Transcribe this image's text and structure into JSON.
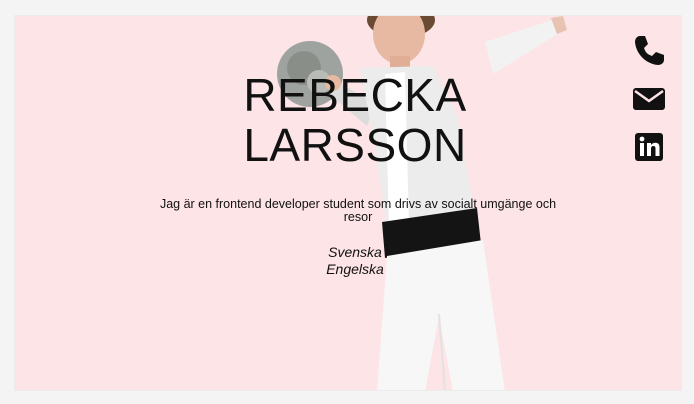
{
  "profile": {
    "first_name": "REBECKA",
    "last_name": "LARSSON",
    "tagline": "Jag är en frontend developer student som drivs av socialt umgänge och resor",
    "languages": [
      "Svenska",
      "Engelska"
    ]
  },
  "contact": {
    "icons": [
      "phone-icon",
      "envelope-icon",
      "linkedin-icon"
    ]
  },
  "colors": {
    "background": "#fde4e6",
    "text": "#111111"
  }
}
